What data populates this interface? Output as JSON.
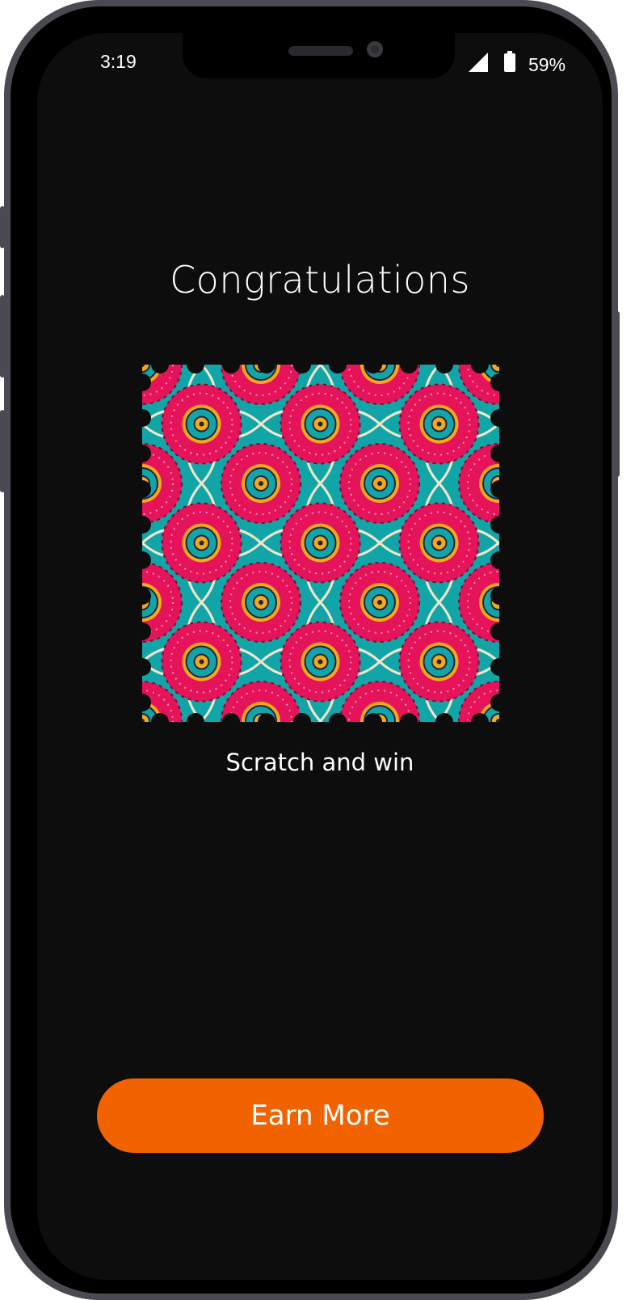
{
  "status_bar": {
    "time": "3:19",
    "battery_percent": "59%",
    "icons": [
      "signal-icon",
      "battery-icon"
    ]
  },
  "main": {
    "title": "Congratulations",
    "scratch_card_subtitle": "Scratch and win",
    "earn_button_label": "Earn More"
  },
  "colors": {
    "background": "#0d0d0d",
    "accent": "#f26300",
    "card_pink": "#e5135a",
    "card_teal": "#12a5a8",
    "card_yellow": "#f5a818"
  }
}
